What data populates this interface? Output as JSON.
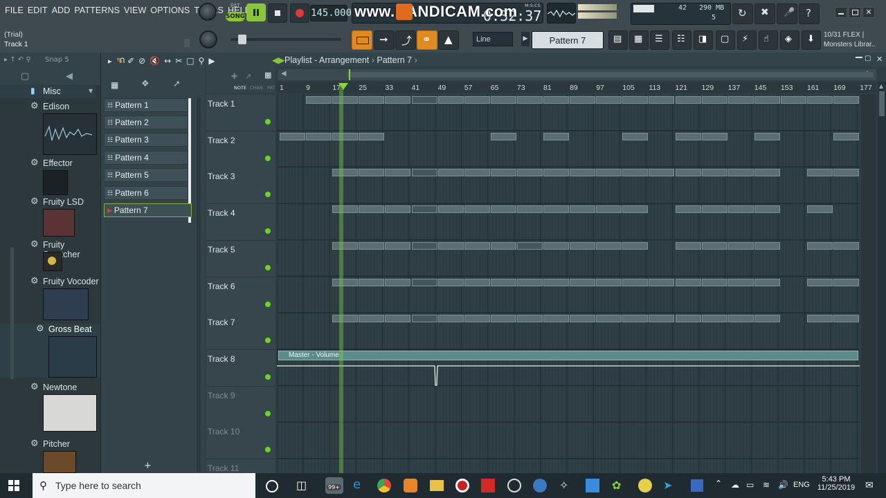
{
  "menu": [
    "FILE",
    "EDIT",
    "ADD",
    "PATTERNS",
    "VIEW",
    "OPTIONS",
    "TOOLS",
    "HELP"
  ],
  "hint": {
    "trial": "(Trial)",
    "track": "Track 1"
  },
  "transport": {
    "pat_label": "PAT",
    "song_label": "SONG",
    "tempo": "145.000",
    "time": "0:32:37",
    "time_label": "M:S:CS"
  },
  "watermark": "www.BANDICAM.com",
  "stats": {
    "cpu": "42",
    "ram": "290 MB",
    "poly": "5"
  },
  "snap": {
    "mode": "Line",
    "pattern": "Pattern 7"
  },
  "news": {
    "line1": "10/31  FLEX |",
    "line2": "Monsters Librar.."
  },
  "browser": {
    "snap_label": "Snap 5",
    "folder": "Misc",
    "plugins": [
      "Edison",
      "Effector",
      "Fruity LSD",
      "Fruity Scratcher",
      "Fruity Vocoder",
      "Gross Beat",
      "Newtone",
      "Pitcher"
    ],
    "selected_plugin": "Gross Beat"
  },
  "patterns": [
    "Pattern 1",
    "Pattern 2",
    "Pattern 3",
    "Pattern 4",
    "Pattern 5",
    "Pattern 6",
    "Pattern 7"
  ],
  "selected_pattern": "Pattern 7",
  "playlist": {
    "title": "Playlist - Arrangement",
    "pattern": "Pattern 7",
    "ruler": [
      "1",
      "9",
      "17",
      "25",
      "33",
      "41",
      "49",
      "57",
      "65",
      "73",
      "81",
      "89",
      "97",
      "105",
      "113",
      "121",
      "129",
      "137",
      "145",
      "153",
      "161",
      "169",
      "177"
    ],
    "tracks": [
      "Track 1",
      "Track 2",
      "Track 3",
      "Track 4",
      "Track 5",
      "Track 6",
      "Track 7",
      "Track 8",
      "Track 9",
      "Track 10",
      "Track 11"
    ],
    "automation_label": "Master - Volume",
    "add_button": "+",
    "header_labels": {
      "note": "NOTE",
      "chan": "CHAN",
      "pat": "PAT"
    }
  },
  "taskbar": {
    "search_placeholder": "Type here to search",
    "badge": "99+",
    "language": "ENG",
    "time": "5:43 PM",
    "date": "11/25/2019"
  },
  "colors": {
    "accent": "#e08a23",
    "playhead": "#8ad33a",
    "led": "#6fcf3a"
  }
}
